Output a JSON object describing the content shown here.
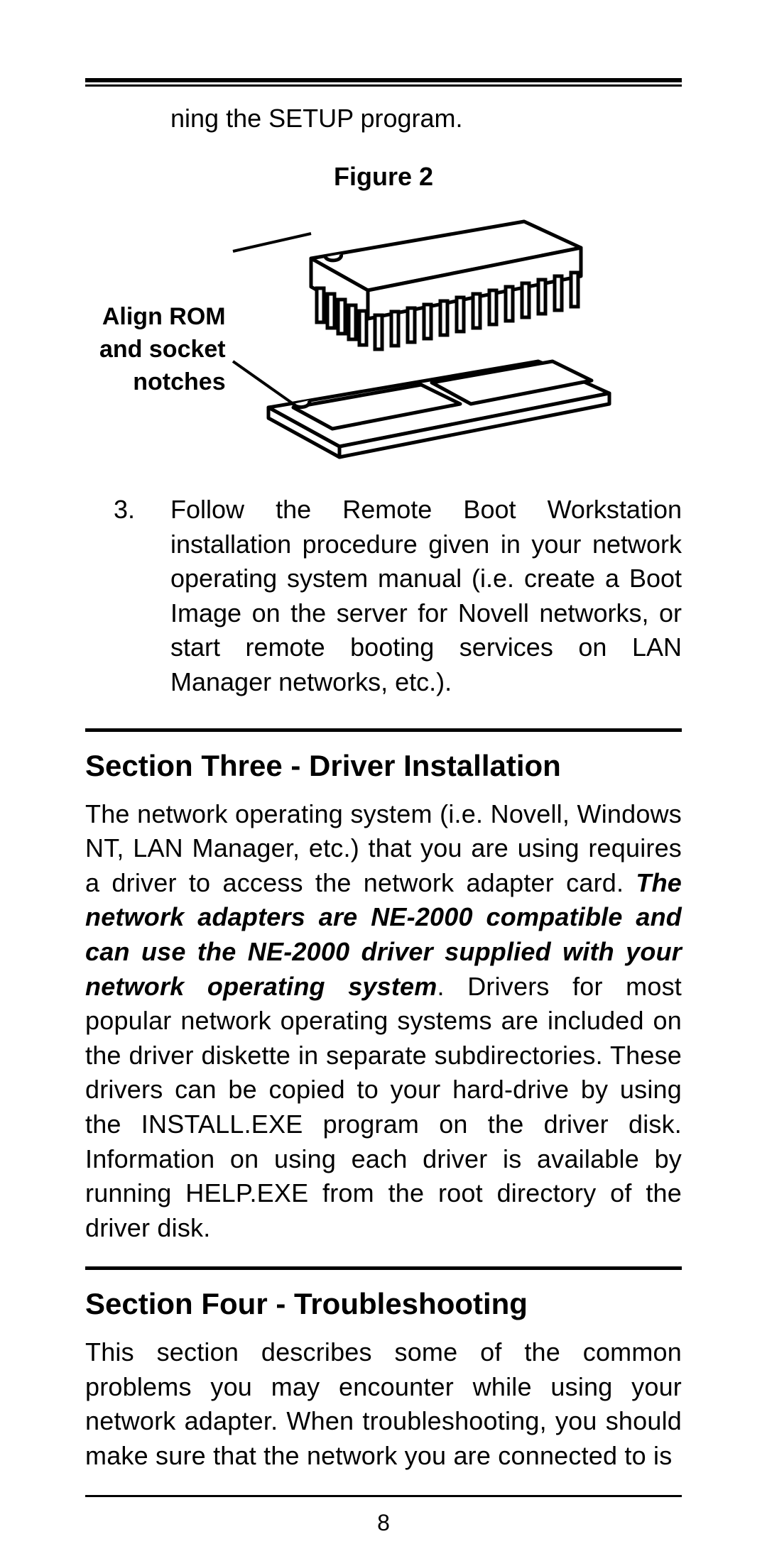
{
  "fragment_line": "ning the SETUP program.",
  "figure_caption": "Figure 2",
  "figure_label_l1": "Align ROM",
  "figure_label_l2": "and socket",
  "figure_label_l3": "notches",
  "step3_num": "3.",
  "step3_text": "Follow the Remote Boot Workstation installation procedure given in your network operating system manual (i.e. create a Boot Image on the server for Novell networks, or start remote booting services on LAN Manager networks, etc.).",
  "section3_heading": "Section Three - Driver Installation",
  "section3_para_a": "The network operating system (i.e. Novell, Windows NT, LAN Manager, etc.) that you are using requires a driver to access the network adapter card. ",
  "section3_para_bi": "The network adapters are NE-2000 compatible and can use the NE-2000 driver supplied with your network operating system",
  "section3_para_b": ". Drivers for most popular network operating systems are included on the driver diskette in separate subdirectories. These drivers can be copied to your hard-drive by using the INSTALL.EXE program on the driver disk. Information on using each driver is available by running HELP.EXE from the root directory of the driver disk.",
  "section4_heading": "Section Four - Troubleshooting",
  "section4_para": "This section describes some of the common problems you may encounter while using your network adapter. When troubleshooting, you should make sure that the network you are connected to is",
  "page_number": "8"
}
